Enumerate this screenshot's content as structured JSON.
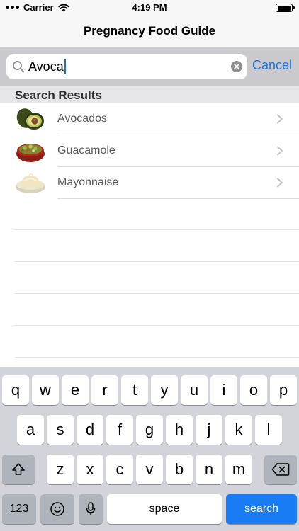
{
  "status_bar": {
    "carrier": "Carrier",
    "time": "4:19 PM"
  },
  "nav": {
    "title": "Pregnancy Food Guide"
  },
  "search": {
    "value": "Avoca",
    "cancel_label": "Cancel"
  },
  "section": {
    "header": "Search Results"
  },
  "results": [
    {
      "label": "Avocados",
      "icon": "avocado-icon"
    },
    {
      "label": "Guacamole",
      "icon": "guacamole-icon"
    },
    {
      "label": "Mayonnaise",
      "icon": "mayonnaise-icon"
    }
  ],
  "keyboard": {
    "row1": [
      "q",
      "w",
      "e",
      "r",
      "t",
      "y",
      "u",
      "i",
      "o",
      "p"
    ],
    "row2": [
      "a",
      "s",
      "d",
      "f",
      "g",
      "h",
      "j",
      "k",
      "l"
    ],
    "row3": [
      "z",
      "x",
      "c",
      "v",
      "b",
      "n",
      "m"
    ],
    "numbers_label": "123",
    "space_label": "space",
    "search_label": "search"
  },
  "colors": {
    "accent": "#1d72d8",
    "search_key": "#1a7cf5",
    "keyboard_bg": "#d2d4d9"
  }
}
